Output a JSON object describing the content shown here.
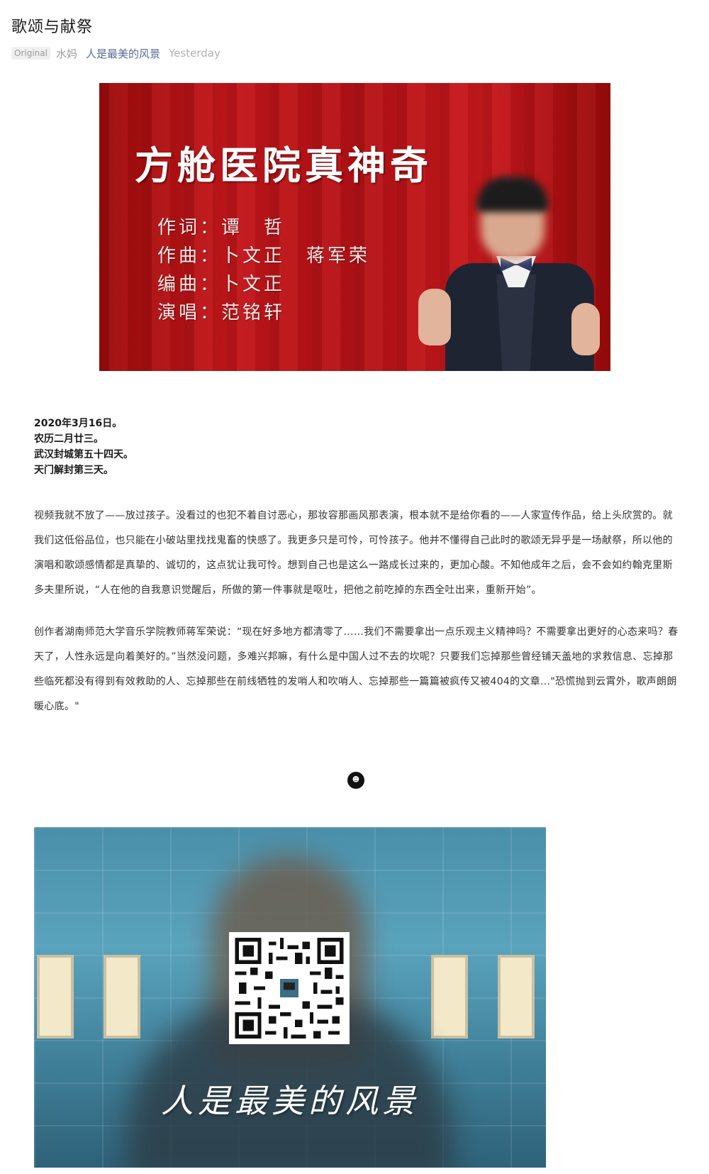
{
  "article": {
    "title": "歌颂与献祭",
    "badge": "Original",
    "author": "水妈",
    "account": "人是最美的风景",
    "date": "Yesterday"
  },
  "cover": {
    "title": "方舱医院真神奇",
    "credits": [
      "作词：谭　哲",
      "作曲：卜文正　蒋军荣",
      "编曲：卜文正",
      "演唱：范铭轩"
    ]
  },
  "date_lines": [
    "2020年3月16日。",
    "农历二月廿三。",
    "武汉封城第五十四天。",
    "天门解封第三天。"
  ],
  "paragraphs": [
    "视频我就不放了——放过孩子。没看过的也犯不着自讨恶心，那妆容那画风那表演，根本就不是给你看的——人家宣传作品，给上头欣赏的。就我们这低俗品位，也只能在小破站里找找鬼畜的快感了。我更多只是可怜，可怜孩子。他并不懂得自己此时的歌颂无异乎是一场献祭，所以他的演唱和歌颂感情都是真挚的、诚切的，这点犹让我可怜。想到自己也是这么一路成长过来的，更加心酸。不知他成年之后，会不会如约翰克里斯多夫里所说，“人在他的自我意识觉醒后，所做的第一件事就是呕吐，把他之前吃掉的东西全吐出来，重新开始”。",
    "创作者湖南师范大学音乐学院教师蒋军荣说：“现在好多地方都清零了……我们不需要拿出一点乐观主义精神吗？不需要拿出更好的心态来吗？春天了，人性永远是向着美好的。”当然没问题，多难兴邦嘛，有什么是中国人过不去的坎呢？只要我们忘掉那些曾经铺天盖地的求救信息、忘掉那些临死都没有得到有效救助的人、忘掉那些在前线牺牲的发哨人和吹哨人、忘掉那些一篇篇被疯传又被404的文章…\"恐慌抛到云霄外，歌声朗朗暖心底。\""
  ],
  "footer": {
    "banner_text": "人是最美的风景"
  }
}
